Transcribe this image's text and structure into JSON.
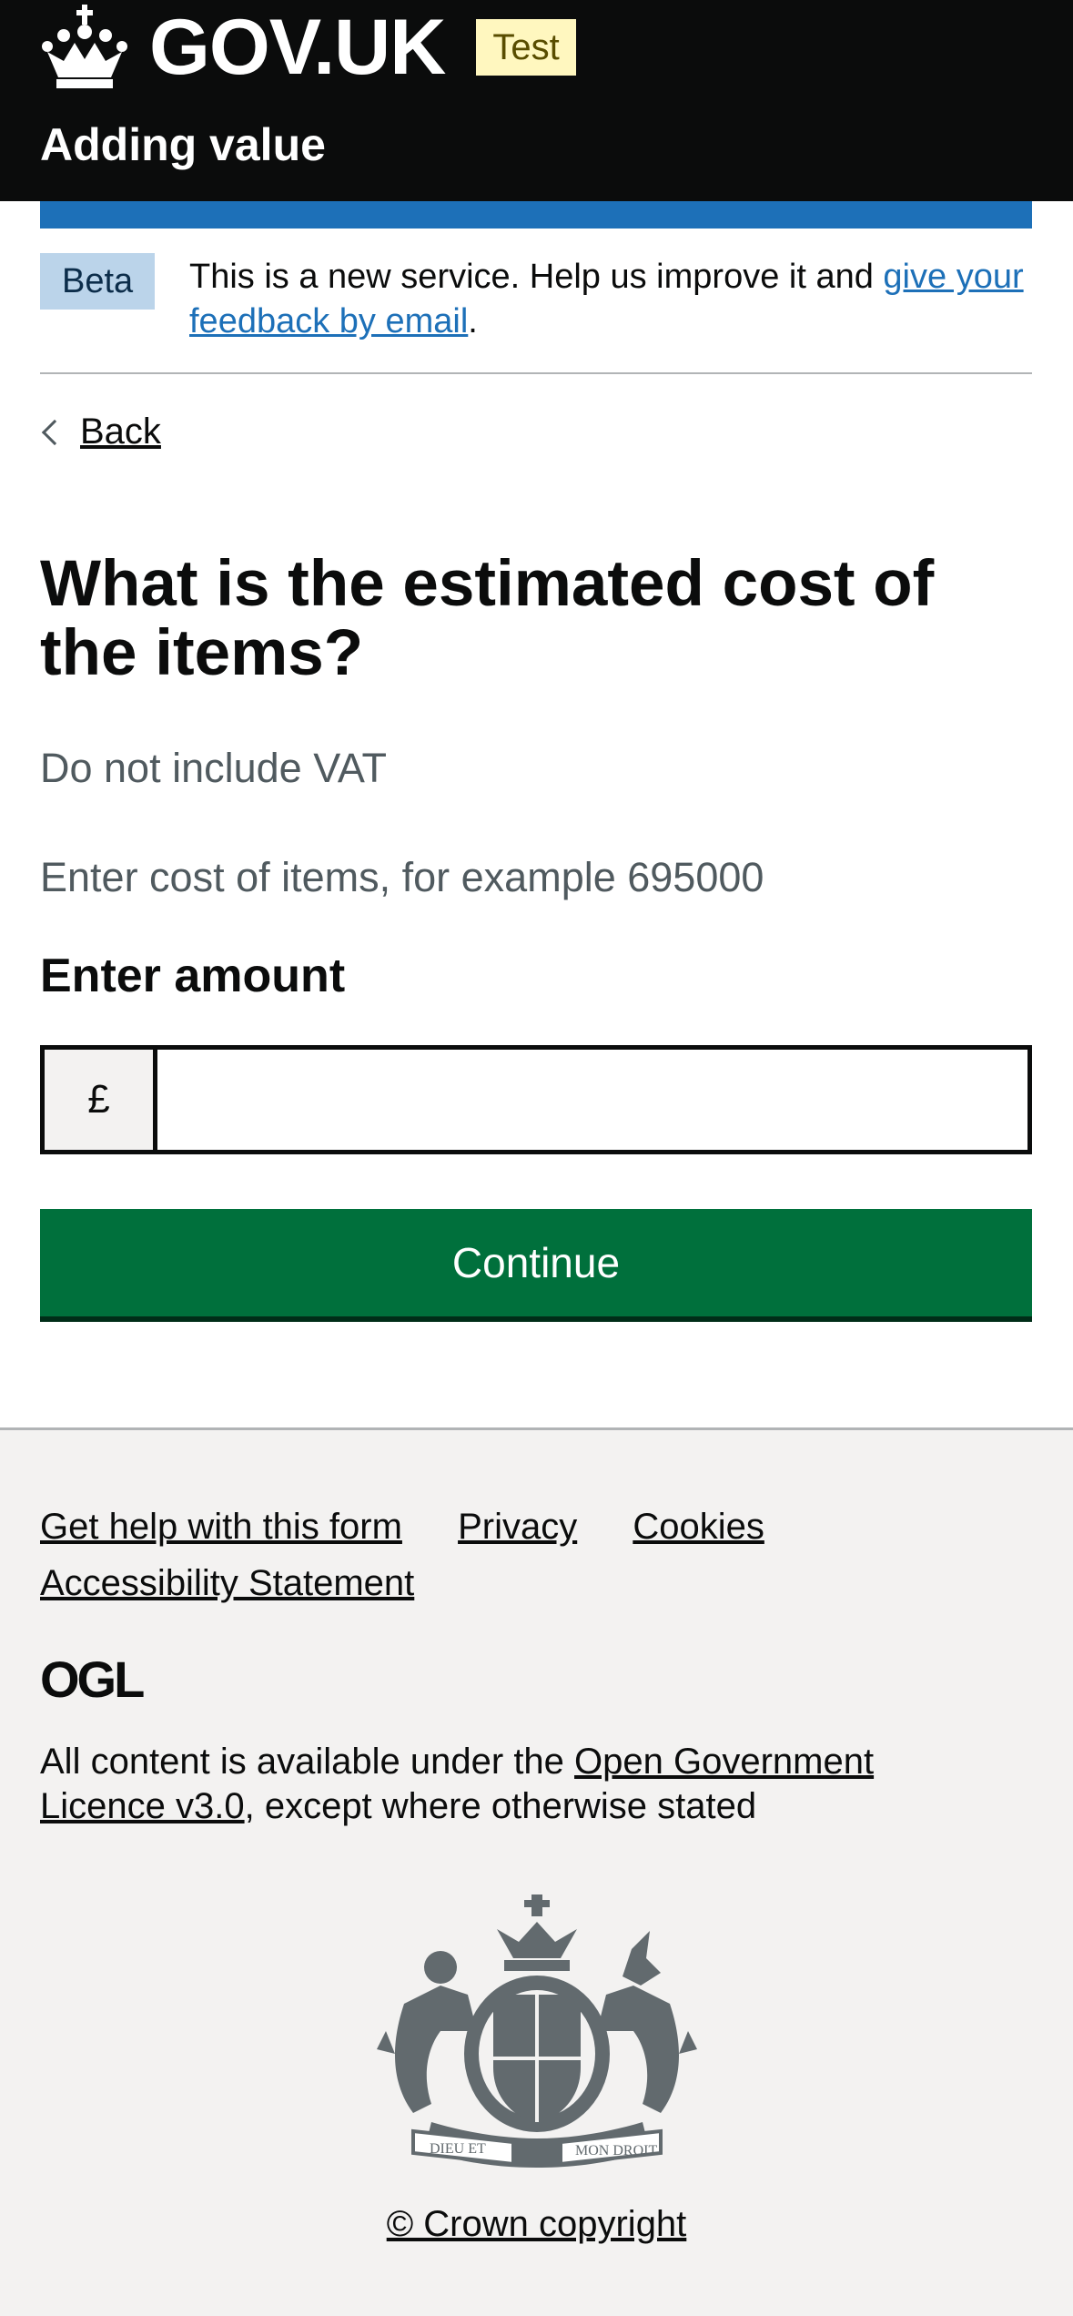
{
  "header": {
    "logo_text": "GOV.UK",
    "environment_tag": "Test",
    "service_name": "Adding value"
  },
  "phase_banner": {
    "tag": "Beta",
    "text_before": "This is a new service. Help us improve it and ",
    "link_text": "give your feedback by email",
    "text_after": "."
  },
  "back_link": "Back",
  "question": {
    "heading": "What is the estimated cost of the items?",
    "hint_vat": "Do not include VAT",
    "hint_example": "Enter cost of items, for example 695000",
    "label": "Enter amount",
    "prefix": "£",
    "value": "",
    "placeholder": ""
  },
  "continue_button": "Continue",
  "footer": {
    "links": [
      "Get help with this form",
      "Privacy",
      "Cookies",
      "Accessibility Statement"
    ],
    "ogl_logo_text": "OGL",
    "licence_before": "All content is available under the ",
    "licence_link": "Open Government Licence v3.0",
    "licence_after": ", except where otherwise stated",
    "crest_motto_left": "DIEU ET",
    "crest_motto_right": "MON DROIT",
    "copyright": "© Crown copyright"
  },
  "colors": {
    "header_bg": "#0b0c0c",
    "brand_blue": "#1d70b8",
    "test_tag_bg": "#fff7bf",
    "beta_tag_bg": "#bbd4ea",
    "button_green": "#00703c",
    "footer_bg": "#f3f2f1",
    "hint_grey": "#505a5f"
  },
  "icons": {
    "crown": "crown-icon",
    "back": "chevron-left-icon",
    "ogl": "ogl-logo",
    "crest": "royal-coat-of-arms"
  }
}
